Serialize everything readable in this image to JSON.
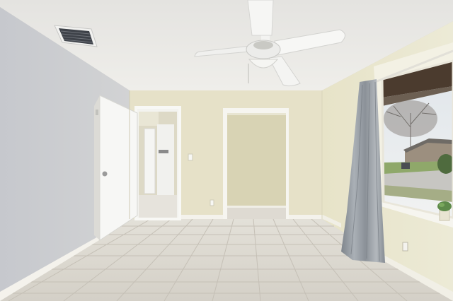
{
  "scene": {
    "colors": {
      "ceiling": "#eceae6",
      "left_wall": "#c9cbd0",
      "back_wall": "#e6e1c8",
      "right_wall": "#e9e5cc",
      "floor_tile": "#d9d5cd",
      "grout": "#c6c1b7",
      "door": "#f7f7f5",
      "curtain": "#9aa0a6",
      "baseboard": "#f4f2ec",
      "sky": "#eef0f2",
      "lawn": "#8fa86a",
      "street": "#c7c6c2"
    },
    "icons": [
      "ceiling-fan",
      "ac-vent",
      "door-handle",
      "light-switch",
      "power-outlet",
      "curtain-rod",
      "potted-plant"
    ]
  }
}
